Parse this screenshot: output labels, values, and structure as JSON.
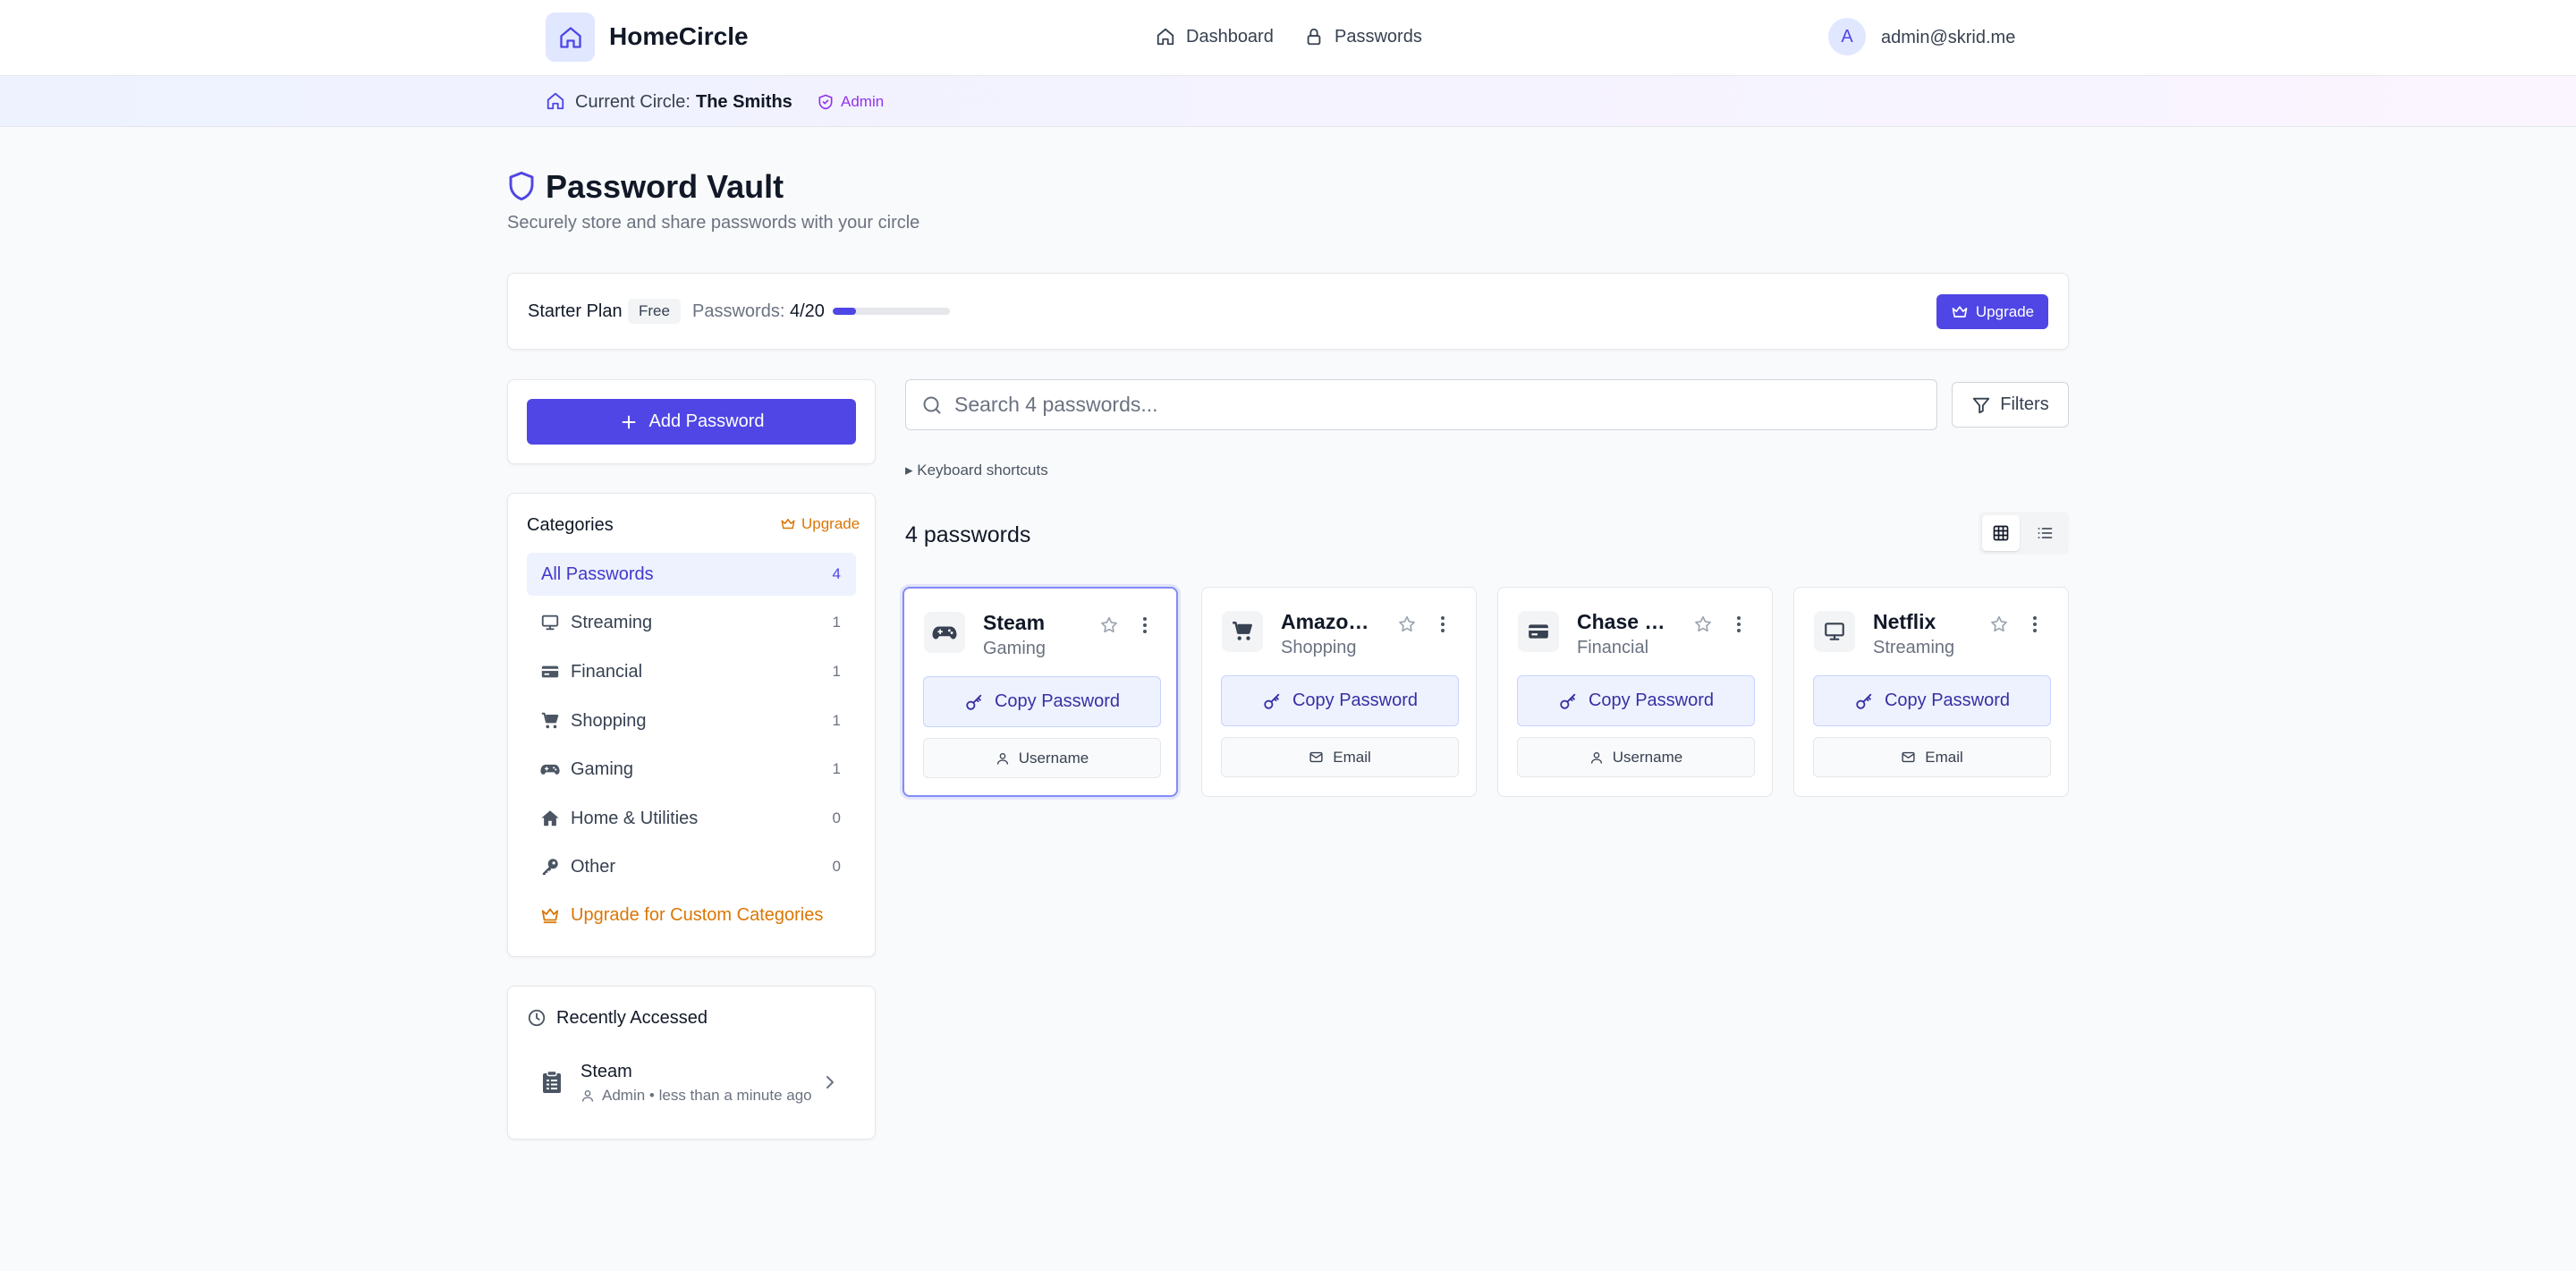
{
  "colors": {
    "accent": "#4f46e5",
    "accent_soft": "#eef2ff",
    "upgrade_orange": "#d97706",
    "admin_purple": "#9333ea"
  },
  "header": {
    "brand": "HomeCircle",
    "nav": [
      {
        "label": "Dashboard",
        "icon": "home-icon"
      },
      {
        "label": "Passwords",
        "icon": "lock-icon"
      }
    ],
    "avatar_letter": "A",
    "user_email": "admin@skrid.me"
  },
  "circle_bar": {
    "label": "Current Circle:",
    "name": "The Smiths",
    "role": "Admin"
  },
  "page": {
    "title": "Password Vault",
    "subtitle": "Securely store and share passwords with your circle"
  },
  "plan": {
    "name": "Starter Plan",
    "badge": "Free",
    "passwords_label": "Passwords:",
    "passwords_value": "4/20",
    "usage_fraction": 0.2,
    "upgrade_label": "Upgrade"
  },
  "sidebar": {
    "add_label": "Add Password",
    "categories_title": "Categories",
    "categories_upgrade": "Upgrade",
    "categories": [
      {
        "label": "All Passwords",
        "count": "4",
        "icon": ""
      },
      {
        "label": "Streaming",
        "count": "1",
        "icon": "monitor-icon"
      },
      {
        "label": "Financial",
        "count": "1",
        "icon": "credit-card-icon"
      },
      {
        "label": "Shopping",
        "count": "1",
        "icon": "cart-icon"
      },
      {
        "label": "Gaming",
        "count": "1",
        "icon": "gamepad-icon"
      },
      {
        "label": "Home & Utilities",
        "count": "0",
        "icon": "house-icon"
      },
      {
        "label": "Other",
        "count": "0",
        "icon": "key-icon"
      }
    ],
    "upgrade_custom": "Upgrade for Custom Categories",
    "recent_title": "Recently Accessed",
    "recent": [
      {
        "name": "Steam",
        "meta": "Admin • less than a minute ago"
      }
    ]
  },
  "main": {
    "search_placeholder": "Search 4 passwords...",
    "filters_label": "Filters",
    "keyboard_shortcuts": "▸ Keyboard shortcuts",
    "count_label": "4 passwords",
    "cards": [
      {
        "name": "Steam",
        "category": "Gaming",
        "icon": "gamepad-icon",
        "copy": "Copy Password",
        "secondary": "Username",
        "secondary_icon": "user-icon"
      },
      {
        "name": "Amazon…",
        "category": "Shopping",
        "icon": "cart-icon",
        "copy": "Copy Password",
        "secondary": "Email",
        "secondary_icon": "mail-icon"
      },
      {
        "name": "Chase B…",
        "category": "Financial",
        "icon": "credit-card-icon",
        "copy": "Copy Password",
        "secondary": "Username",
        "secondary_icon": "user-icon"
      },
      {
        "name": "Netflix",
        "category": "Streaming",
        "icon": "monitor-icon",
        "copy": "Copy Password",
        "secondary": "Email",
        "secondary_icon": "mail-icon"
      }
    ]
  }
}
